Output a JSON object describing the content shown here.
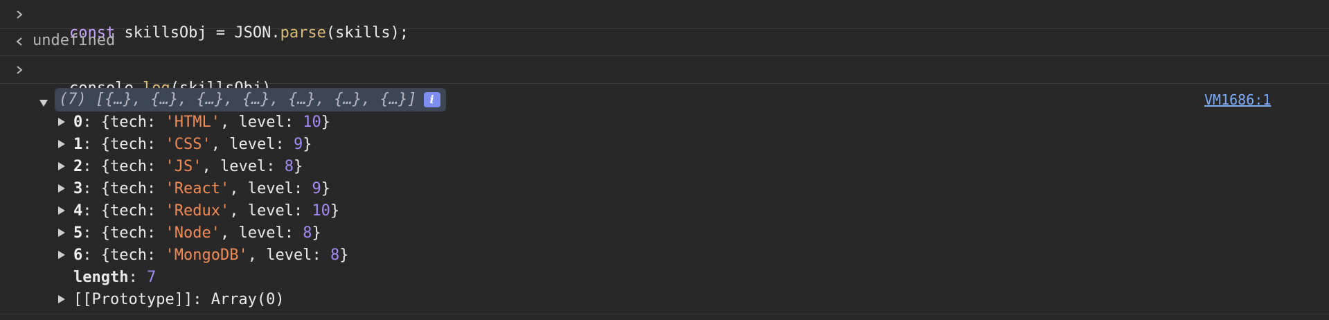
{
  "entries": [
    {
      "type": "input",
      "parts": [
        {
          "kind": "kw",
          "text": "const"
        },
        {
          "kind": "plain",
          "text": " skillsObj = JSON."
        },
        {
          "kind": "fn",
          "text": "parse"
        },
        {
          "kind": "plain",
          "text": "(skills);"
        }
      ]
    },
    {
      "type": "result",
      "text": "undefined"
    },
    {
      "type": "input",
      "parts": [
        {
          "kind": "plain",
          "text": "console."
        },
        {
          "kind": "fn",
          "text": "log"
        },
        {
          "kind": "plain",
          "text": "(skillsObj)"
        }
      ]
    }
  ],
  "output": {
    "summary": "(7) [{…}, {…}, {…}, {…}, {…}, {…}, {…}]",
    "info_icon": "i",
    "source": "VM1686:1",
    "tech_key": "tech",
    "level_key": "level",
    "items": [
      {
        "index": "0",
        "tech": "'HTML'",
        "level": "10"
      },
      {
        "index": "1",
        "tech": "'CSS'",
        "level": "9"
      },
      {
        "index": "2",
        "tech": "'JS'",
        "level": "8"
      },
      {
        "index": "3",
        "tech": "'React'",
        "level": "9"
      },
      {
        "index": "4",
        "tech": "'Redux'",
        "level": "10"
      },
      {
        "index": "5",
        "tech": "'Node'",
        "level": "8"
      },
      {
        "index": "6",
        "tech": "'MongoDB'",
        "level": "8"
      }
    ],
    "length_label": "length",
    "length_value": "7",
    "prototype_label": "[[Prototype]]",
    "prototype_value": "Array(0)"
  },
  "colors": {
    "background": "#282828",
    "keyword": "#c6a1ff",
    "function": "#dcbd78",
    "string": "#f28b54",
    "number": "#a18cf5",
    "link": "#7cacf8"
  }
}
